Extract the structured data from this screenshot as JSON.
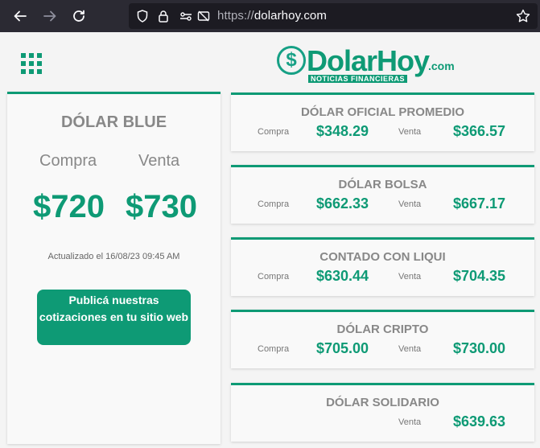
{
  "browser": {
    "url_scheme": "https://",
    "url_host": "dolarhoy.com"
  },
  "logo": {
    "icon": "$",
    "word": "DolarHoy",
    "suffix": ".com",
    "tagline": "NOTICIAS FINANCIERAS"
  },
  "main": {
    "title": "DÓLAR BLUE",
    "compra_label": "Compra",
    "venta_label": "Venta",
    "compra_value": "$720",
    "venta_value": "$730",
    "updated": "Actualizado el 16/08/23 09:45 AM",
    "cta": "Publicá nuestras cotizaciones en tu sitio web"
  },
  "rates": [
    {
      "title": "DÓLAR OFICIAL PROMEDIO",
      "compra_label": "Compra",
      "compra": "$348.29",
      "venta_label": "Venta",
      "venta": "$366.57"
    },
    {
      "title": "DÓLAR BOLSA",
      "compra_label": "Compra",
      "compra": "$662.33",
      "venta_label": "Venta",
      "venta": "$667.17"
    },
    {
      "title": "CONTADO CON LIQUI",
      "compra_label": "Compra",
      "compra": "$630.44",
      "venta_label": "Venta",
      "venta": "$704.35"
    },
    {
      "title": "DÓLAR CRIPTO",
      "compra_label": "Compra",
      "compra": "$705.00",
      "venta_label": "Venta",
      "venta": "$730.00"
    },
    {
      "title": "DÓLAR SOLIDARIO",
      "venta_label": "Venta",
      "venta": "$639.63"
    }
  ],
  "icons": {
    "back": "back-arrow-icon",
    "forward": "forward-arrow-icon",
    "reload": "reload-icon",
    "shield": "shield-icon",
    "lock": "lock-icon",
    "permissions": "permissions-icon",
    "tracking": "tracking-blocked-icon",
    "bookmark": "bookmark-star-icon",
    "menu": "grid-menu-icon"
  },
  "colors": {
    "accent": "#0e9a75",
    "chrome": "#2b2a33",
    "urlbar": "#1c1b22"
  }
}
